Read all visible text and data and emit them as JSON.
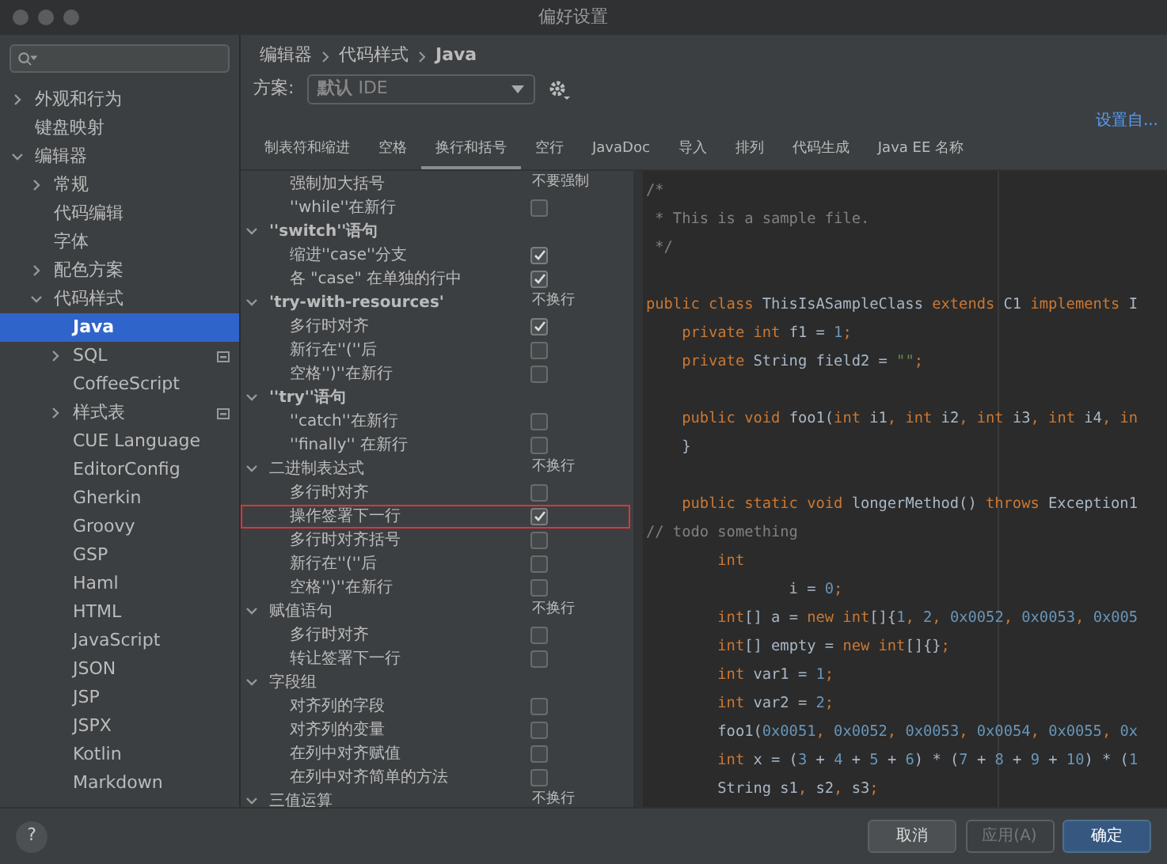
{
  "window": {
    "title": "偏好设置"
  },
  "sidebar": {
    "items": [
      {
        "label": "外观和行为",
        "expanded": false,
        "selected": false
      },
      {
        "label": "键盘映射",
        "selected": false
      },
      {
        "label": "编辑器",
        "expanded": true,
        "selected": false,
        "children": [
          {
            "label": "常规",
            "expanded": false,
            "selected": false
          },
          {
            "label": "代码编辑",
            "selected": false
          },
          {
            "label": "字体",
            "selected": false
          },
          {
            "label": "配色方案",
            "expanded": false,
            "selected": false
          },
          {
            "label": "代码样式",
            "expanded": true,
            "selected": false,
            "children": [
              {
                "label": "Java",
                "selected": true
              },
              {
                "label": "SQL",
                "expanded": false,
                "selected": false,
                "marked": true
              },
              {
                "label": "CoffeeScript",
                "selected": false
              },
              {
                "label": "样式表",
                "expanded": false,
                "selected": false,
                "marked": true
              },
              {
                "label": "CUE Language",
                "selected": false
              },
              {
                "label": "EditorConfig",
                "selected": false
              },
              {
                "label": "Gherkin",
                "selected": false
              },
              {
                "label": "Groovy",
                "selected": false
              },
              {
                "label": "GSP",
                "selected": false
              },
              {
                "label": "Haml",
                "selected": false
              },
              {
                "label": "HTML",
                "selected": false
              },
              {
                "label": "JavaScript",
                "selected": false
              },
              {
                "label": "JSON",
                "selected": false
              },
              {
                "label": "JSP",
                "selected": false
              },
              {
                "label": "JSPX",
                "selected": false
              },
              {
                "label": "Kotlin",
                "selected": false
              },
              {
                "label": "Markdown",
                "selected": false
              }
            ]
          }
        ]
      }
    ]
  },
  "breadcrumb": [
    "编辑器",
    "代码样式",
    "Java"
  ],
  "scheme": {
    "label": "方案:",
    "value_bold": "默认",
    "value": "IDE"
  },
  "set_from_link": "设置自...",
  "tabs": [
    {
      "label": "制表符和缩进",
      "selected": false
    },
    {
      "label": "空格",
      "selected": false
    },
    {
      "label": "换行和括号",
      "selected": true
    },
    {
      "label": "空行",
      "selected": false
    },
    {
      "label": "JavaDoc",
      "selected": false
    },
    {
      "label": "导入",
      "selected": false
    },
    {
      "label": "排列",
      "selected": false
    },
    {
      "label": "代码生成",
      "selected": false
    },
    {
      "label": "Java EE 名称",
      "selected": false
    }
  ],
  "settings": [
    {
      "children": [
        {
          "kind": "choice",
          "label": "强制加大括号",
          "value": "不要强制",
          "highlighted": false
        },
        {
          "kind": "checkbox",
          "label": "''while''在新行",
          "checked": false,
          "highlighted": false
        }
      ]
    },
    {
      "label": "''switch''语句",
      "expanded": true,
      "children": [
        {
          "kind": "checkbox",
          "label": "缩进''case''分支",
          "checked": true,
          "highlighted": false
        },
        {
          "kind": "checkbox",
          "label": "各 \"case\" 在单独的行中",
          "checked": true,
          "highlighted": false
        }
      ]
    },
    {
      "label": "'try-with-resources'",
      "value": "不换行",
      "expanded": true,
      "children": [
        {
          "kind": "checkbox",
          "label": "多行时对齐",
          "checked": true,
          "highlighted": false
        },
        {
          "kind": "checkbox",
          "label": "新行在''(''后",
          "checked": false,
          "highlighted": false
        },
        {
          "kind": "checkbox",
          "label": "空格'')''在新行",
          "checked": false,
          "highlighted": false
        }
      ]
    },
    {
      "label": "''try''语句",
      "expanded": true,
      "children": [
        {
          "kind": "checkbox",
          "label": "''catch''在新行",
          "checked": false,
          "highlighted": false
        },
        {
          "kind": "checkbox",
          "label": "''finally'' 在新行",
          "checked": false,
          "highlighted": false
        }
      ]
    },
    {
      "label": "二进制表达式",
      "value": "不换行",
      "expanded": true,
      "children": [
        {
          "kind": "checkbox",
          "label": "多行时对齐",
          "checked": false,
          "highlighted": false
        },
        {
          "kind": "checkbox",
          "label": "操作签署下一行",
          "checked": true,
          "highlighted": true
        },
        {
          "kind": "checkbox",
          "label": "多行时对齐括号",
          "checked": false,
          "highlighted": false
        },
        {
          "kind": "checkbox",
          "label": "新行在''(''后",
          "checked": false,
          "highlighted": false
        },
        {
          "kind": "checkbox",
          "label": "空格'')''在新行",
          "checked": false,
          "highlighted": false
        }
      ]
    },
    {
      "label": "赋值语句",
      "value": "不换行",
      "expanded": true,
      "children": [
        {
          "kind": "checkbox",
          "label": "多行时对齐",
          "checked": false,
          "highlighted": false
        },
        {
          "kind": "checkbox",
          "label": "转让签署下一行",
          "checked": false,
          "highlighted": false
        }
      ]
    },
    {
      "label": "字段组",
      "expanded": true,
      "children": [
        {
          "kind": "checkbox",
          "label": "对齐列的字段",
          "checked": false,
          "highlighted": false
        },
        {
          "kind": "checkbox",
          "label": "对齐列的变量",
          "checked": false,
          "highlighted": false
        },
        {
          "kind": "checkbox",
          "label": "在列中对齐赋值",
          "checked": false,
          "highlighted": false
        },
        {
          "kind": "checkbox",
          "label": "在列中对齐简单的方法",
          "checked": false,
          "highlighted": false
        }
      ]
    },
    {
      "label": "三值运算",
      "value": "不换行",
      "expanded": true
    }
  ],
  "code_lines": [
    {
      "kind": "code",
      "tokens": [
        {
          "kind": "comment",
          "text": "/*"
        }
      ]
    },
    {
      "kind": "code",
      "tokens": [
        {
          "kind": "comment",
          "text": " * This is a sample file."
        }
      ]
    },
    {
      "kind": "code",
      "tokens": [
        {
          "kind": "comment",
          "text": " */"
        }
      ]
    },
    {
      "kind": "blank"
    },
    {
      "kind": "code",
      "tokens": [
        {
          "kind": "keyword",
          "text": "public class "
        },
        {
          "kind": "plain",
          "text": "ThisIsASampleClass "
        },
        {
          "kind": "keyword",
          "text": "extends "
        },
        {
          "kind": "plain",
          "text": "C1 "
        },
        {
          "kind": "keyword",
          "text": "implements "
        },
        {
          "kind": "plain",
          "text": "I"
        }
      ]
    },
    {
      "kind": "code",
      "tokens": [
        {
          "kind": "keyword",
          "text": "    private int "
        },
        {
          "kind": "plain",
          "text": "f1 = "
        },
        {
          "kind": "number",
          "text": "1"
        },
        {
          "kind": "keyword",
          "text": ";"
        }
      ]
    },
    {
      "kind": "code",
      "tokens": [
        {
          "kind": "keyword",
          "text": "    private "
        },
        {
          "kind": "plain",
          "text": "String field2 = "
        },
        {
          "kind": "string",
          "text": "\"\""
        },
        {
          "kind": "keyword",
          "text": ";"
        }
      ]
    },
    {
      "kind": "blank"
    },
    {
      "kind": "code",
      "tokens": [
        {
          "kind": "keyword",
          "text": "    public void "
        },
        {
          "kind": "plain",
          "text": "foo1("
        },
        {
          "kind": "keyword",
          "text": "int "
        },
        {
          "kind": "plain",
          "text": "i1"
        },
        {
          "kind": "keyword",
          "text": ", int "
        },
        {
          "kind": "plain",
          "text": "i2"
        },
        {
          "kind": "keyword",
          "text": ", int "
        },
        {
          "kind": "plain",
          "text": "i3"
        },
        {
          "kind": "keyword",
          "text": ", int "
        },
        {
          "kind": "plain",
          "text": "i4"
        },
        {
          "kind": "keyword",
          "text": ", in"
        }
      ]
    },
    {
      "kind": "code",
      "tokens": [
        {
          "kind": "plain",
          "text": "    }"
        }
      ]
    },
    {
      "kind": "blank"
    },
    {
      "kind": "code",
      "tokens": [
        {
          "kind": "keyword",
          "text": "    public static void "
        },
        {
          "kind": "plain",
          "text": "longerMethod() "
        },
        {
          "kind": "keyword",
          "text": "throws "
        },
        {
          "kind": "plain",
          "text": "Exception1"
        }
      ]
    },
    {
      "kind": "code",
      "tokens": [
        {
          "kind": "comment",
          "text": "// todo something"
        }
      ]
    },
    {
      "kind": "code",
      "tokens": [
        {
          "kind": "keyword",
          "text": "        int"
        }
      ]
    },
    {
      "kind": "code",
      "tokens": [
        {
          "kind": "plain",
          "text": "                i = "
        },
        {
          "kind": "number",
          "text": "0"
        },
        {
          "kind": "keyword",
          "text": ";"
        }
      ]
    },
    {
      "kind": "code",
      "tokens": [
        {
          "kind": "keyword",
          "text": "        int"
        },
        {
          "kind": "plain",
          "text": "[] a = "
        },
        {
          "kind": "keyword",
          "text": "new int"
        },
        {
          "kind": "plain",
          "text": "[]{"
        },
        {
          "kind": "number",
          "text": "1"
        },
        {
          "kind": "keyword",
          "text": ", "
        },
        {
          "kind": "number",
          "text": "2"
        },
        {
          "kind": "keyword",
          "text": ", "
        },
        {
          "kind": "number",
          "text": "0x0052"
        },
        {
          "kind": "keyword",
          "text": ", "
        },
        {
          "kind": "number",
          "text": "0x0053"
        },
        {
          "kind": "keyword",
          "text": ", "
        },
        {
          "kind": "number",
          "text": "0x005"
        }
      ]
    },
    {
      "kind": "code",
      "tokens": [
        {
          "kind": "keyword",
          "text": "        int"
        },
        {
          "kind": "plain",
          "text": "[] empty = "
        },
        {
          "kind": "keyword",
          "text": "new int"
        },
        {
          "kind": "plain",
          "text": "[]{}"
        },
        {
          "kind": "keyword",
          "text": ";"
        }
      ]
    },
    {
      "kind": "code",
      "tokens": [
        {
          "kind": "keyword",
          "text": "        int "
        },
        {
          "kind": "plain",
          "text": "var1 = "
        },
        {
          "kind": "number",
          "text": "1"
        },
        {
          "kind": "keyword",
          "text": ";"
        }
      ]
    },
    {
      "kind": "code",
      "tokens": [
        {
          "kind": "keyword",
          "text": "        int "
        },
        {
          "kind": "plain",
          "text": "var2 = "
        },
        {
          "kind": "number",
          "text": "2"
        },
        {
          "kind": "keyword",
          "text": ";"
        }
      ]
    },
    {
      "kind": "code",
      "tokens": [
        {
          "kind": "plain",
          "text": "        foo1("
        },
        {
          "kind": "number",
          "text": "0x0051"
        },
        {
          "kind": "keyword",
          "text": ", "
        },
        {
          "kind": "number",
          "text": "0x0052"
        },
        {
          "kind": "keyword",
          "text": ", "
        },
        {
          "kind": "number",
          "text": "0x0053"
        },
        {
          "kind": "keyword",
          "text": ", "
        },
        {
          "kind": "number",
          "text": "0x0054"
        },
        {
          "kind": "keyword",
          "text": ", "
        },
        {
          "kind": "number",
          "text": "0x0055"
        },
        {
          "kind": "keyword",
          "text": ", "
        },
        {
          "kind": "number",
          "text": "0x"
        }
      ]
    },
    {
      "kind": "code",
      "tokens": [
        {
          "kind": "keyword",
          "text": "        int "
        },
        {
          "kind": "plain",
          "text": "x = ("
        },
        {
          "kind": "number",
          "text": "3"
        },
        {
          "kind": "plain",
          "text": " + "
        },
        {
          "kind": "number",
          "text": "4"
        },
        {
          "kind": "plain",
          "text": " + "
        },
        {
          "kind": "number",
          "text": "5"
        },
        {
          "kind": "plain",
          "text": " + "
        },
        {
          "kind": "number",
          "text": "6"
        },
        {
          "kind": "plain",
          "text": ") * ("
        },
        {
          "kind": "number",
          "text": "7"
        },
        {
          "kind": "plain",
          "text": " + "
        },
        {
          "kind": "number",
          "text": "8"
        },
        {
          "kind": "plain",
          "text": " + "
        },
        {
          "kind": "number",
          "text": "9"
        },
        {
          "kind": "plain",
          "text": " + "
        },
        {
          "kind": "number",
          "text": "10"
        },
        {
          "kind": "plain",
          "text": ") * ("
        },
        {
          "kind": "number",
          "text": "1"
        }
      ]
    },
    {
      "kind": "code",
      "tokens": [
        {
          "kind": "plain",
          "text": "        String s1"
        },
        {
          "kind": "keyword",
          "text": ", "
        },
        {
          "kind": "plain",
          "text": "s2"
        },
        {
          "kind": "keyword",
          "text": ", "
        },
        {
          "kind": "plain",
          "text": "s3"
        },
        {
          "kind": "keyword",
          "text": ";"
        }
      ]
    }
  ],
  "buttons": [
    {
      "kind": "cancel",
      "label": "取消",
      "disabled": false
    },
    {
      "kind": "apply",
      "label": "应用(A)",
      "disabled": true
    },
    {
      "kind": "ok",
      "label": "确定",
      "disabled": false
    }
  ],
  "help": "?"
}
